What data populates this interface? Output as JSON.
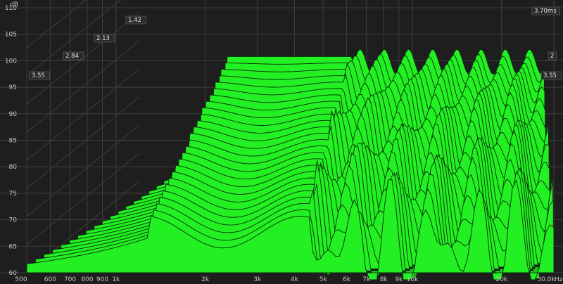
{
  "chart_data": {
    "type": "waterfall",
    "y_unit": "dB",
    "x_unit": "Hz",
    "x_scale": "log",
    "ylim": [
      60,
      110
    ],
    "xlim": [
      500,
      30000
    ],
    "y_ticks": [
      "60",
      "65",
      "70",
      "75",
      "80",
      "85",
      "90",
      "95",
      "100",
      "105",
      "110"
    ],
    "x_ticks": [
      {
        "label": "500",
        "value": 500
      },
      {
        "label": "600",
        "value": 600
      },
      {
        "label": "700",
        "value": 700
      },
      {
        "label": "800",
        "value": 800
      },
      {
        "label": "900",
        "value": 900
      },
      {
        "label": "1k",
        "value": 1000
      },
      {
        "label": "2k",
        "value": 2000
      },
      {
        "label": "3k",
        "value": 3000
      },
      {
        "label": "4k",
        "value": 4000
      },
      {
        "label": "5k",
        "value": 5000
      },
      {
        "label": "6k",
        "value": 6000
      },
      {
        "label": "7k",
        "value": 7000
      },
      {
        "label": "8k",
        "value": 8000
      },
      {
        "label": "9k",
        "value": 9000
      },
      {
        "label": "10k",
        "value": 10000
      },
      {
        "label": "20k",
        "value": 20000
      },
      {
        "label": "30.0k",
        "value": 30000
      }
    ],
    "time_labels_left": [
      "1.42",
      "2.13",
      "2.84",
      "3.55"
    ],
    "time_labels_right": [
      "3.70ms",
      "2",
      "3.55"
    ],
    "fill_color": "#22f022",
    "line_color": "#0a2a0a",
    "background": "#1e1e1e",
    "grid": true,
    "slices": 26
  }
}
